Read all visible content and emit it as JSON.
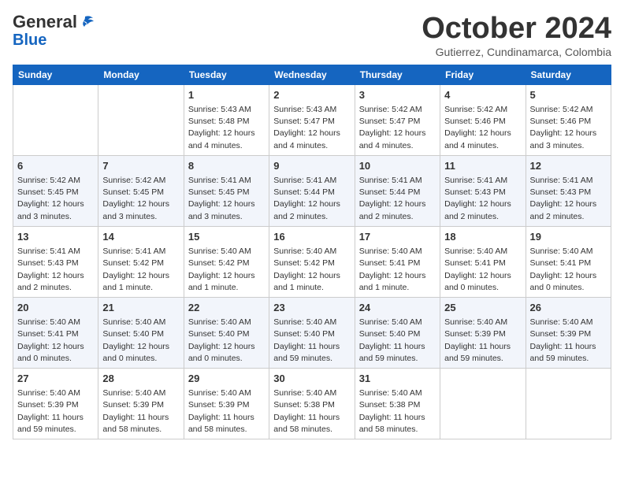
{
  "header": {
    "logo_general": "General",
    "logo_blue": "Blue",
    "month": "October 2024",
    "location": "Gutierrez, Cundinamarca, Colombia"
  },
  "weekdays": [
    "Sunday",
    "Monday",
    "Tuesday",
    "Wednesday",
    "Thursday",
    "Friday",
    "Saturday"
  ],
  "weeks": [
    [
      {
        "day": "",
        "info": ""
      },
      {
        "day": "",
        "info": ""
      },
      {
        "day": "1",
        "info": "Sunrise: 5:43 AM\nSunset: 5:48 PM\nDaylight: 12 hours\nand 4 minutes."
      },
      {
        "day": "2",
        "info": "Sunrise: 5:43 AM\nSunset: 5:47 PM\nDaylight: 12 hours\nand 4 minutes."
      },
      {
        "day": "3",
        "info": "Sunrise: 5:42 AM\nSunset: 5:47 PM\nDaylight: 12 hours\nand 4 minutes."
      },
      {
        "day": "4",
        "info": "Sunrise: 5:42 AM\nSunset: 5:46 PM\nDaylight: 12 hours\nand 4 minutes."
      },
      {
        "day": "5",
        "info": "Sunrise: 5:42 AM\nSunset: 5:46 PM\nDaylight: 12 hours\nand 3 minutes."
      }
    ],
    [
      {
        "day": "6",
        "info": "Sunrise: 5:42 AM\nSunset: 5:45 PM\nDaylight: 12 hours\nand 3 minutes."
      },
      {
        "day": "7",
        "info": "Sunrise: 5:42 AM\nSunset: 5:45 PM\nDaylight: 12 hours\nand 3 minutes."
      },
      {
        "day": "8",
        "info": "Sunrise: 5:41 AM\nSunset: 5:45 PM\nDaylight: 12 hours\nand 3 minutes."
      },
      {
        "day": "9",
        "info": "Sunrise: 5:41 AM\nSunset: 5:44 PM\nDaylight: 12 hours\nand 2 minutes."
      },
      {
        "day": "10",
        "info": "Sunrise: 5:41 AM\nSunset: 5:44 PM\nDaylight: 12 hours\nand 2 minutes."
      },
      {
        "day": "11",
        "info": "Sunrise: 5:41 AM\nSunset: 5:43 PM\nDaylight: 12 hours\nand 2 minutes."
      },
      {
        "day": "12",
        "info": "Sunrise: 5:41 AM\nSunset: 5:43 PM\nDaylight: 12 hours\nand 2 minutes."
      }
    ],
    [
      {
        "day": "13",
        "info": "Sunrise: 5:41 AM\nSunset: 5:43 PM\nDaylight: 12 hours\nand 2 minutes."
      },
      {
        "day": "14",
        "info": "Sunrise: 5:41 AM\nSunset: 5:42 PM\nDaylight: 12 hours\nand 1 minute."
      },
      {
        "day": "15",
        "info": "Sunrise: 5:40 AM\nSunset: 5:42 PM\nDaylight: 12 hours\nand 1 minute."
      },
      {
        "day": "16",
        "info": "Sunrise: 5:40 AM\nSunset: 5:42 PM\nDaylight: 12 hours\nand 1 minute."
      },
      {
        "day": "17",
        "info": "Sunrise: 5:40 AM\nSunset: 5:41 PM\nDaylight: 12 hours\nand 1 minute."
      },
      {
        "day": "18",
        "info": "Sunrise: 5:40 AM\nSunset: 5:41 PM\nDaylight: 12 hours\nand 0 minutes."
      },
      {
        "day": "19",
        "info": "Sunrise: 5:40 AM\nSunset: 5:41 PM\nDaylight: 12 hours\nand 0 minutes."
      }
    ],
    [
      {
        "day": "20",
        "info": "Sunrise: 5:40 AM\nSunset: 5:41 PM\nDaylight: 12 hours\nand 0 minutes."
      },
      {
        "day": "21",
        "info": "Sunrise: 5:40 AM\nSunset: 5:40 PM\nDaylight: 12 hours\nand 0 minutes."
      },
      {
        "day": "22",
        "info": "Sunrise: 5:40 AM\nSunset: 5:40 PM\nDaylight: 12 hours\nand 0 minutes."
      },
      {
        "day": "23",
        "info": "Sunrise: 5:40 AM\nSunset: 5:40 PM\nDaylight: 11 hours\nand 59 minutes."
      },
      {
        "day": "24",
        "info": "Sunrise: 5:40 AM\nSunset: 5:40 PM\nDaylight: 11 hours\nand 59 minutes."
      },
      {
        "day": "25",
        "info": "Sunrise: 5:40 AM\nSunset: 5:39 PM\nDaylight: 11 hours\nand 59 minutes."
      },
      {
        "day": "26",
        "info": "Sunrise: 5:40 AM\nSunset: 5:39 PM\nDaylight: 11 hours\nand 59 minutes."
      }
    ],
    [
      {
        "day": "27",
        "info": "Sunrise: 5:40 AM\nSunset: 5:39 PM\nDaylight: 11 hours\nand 59 minutes."
      },
      {
        "day": "28",
        "info": "Sunrise: 5:40 AM\nSunset: 5:39 PM\nDaylight: 11 hours\nand 58 minutes."
      },
      {
        "day": "29",
        "info": "Sunrise: 5:40 AM\nSunset: 5:39 PM\nDaylight: 11 hours\nand 58 minutes."
      },
      {
        "day": "30",
        "info": "Sunrise: 5:40 AM\nSunset: 5:38 PM\nDaylight: 11 hours\nand 58 minutes."
      },
      {
        "day": "31",
        "info": "Sunrise: 5:40 AM\nSunset: 5:38 PM\nDaylight: 11 hours\nand 58 minutes."
      },
      {
        "day": "",
        "info": ""
      },
      {
        "day": "",
        "info": ""
      }
    ]
  ]
}
